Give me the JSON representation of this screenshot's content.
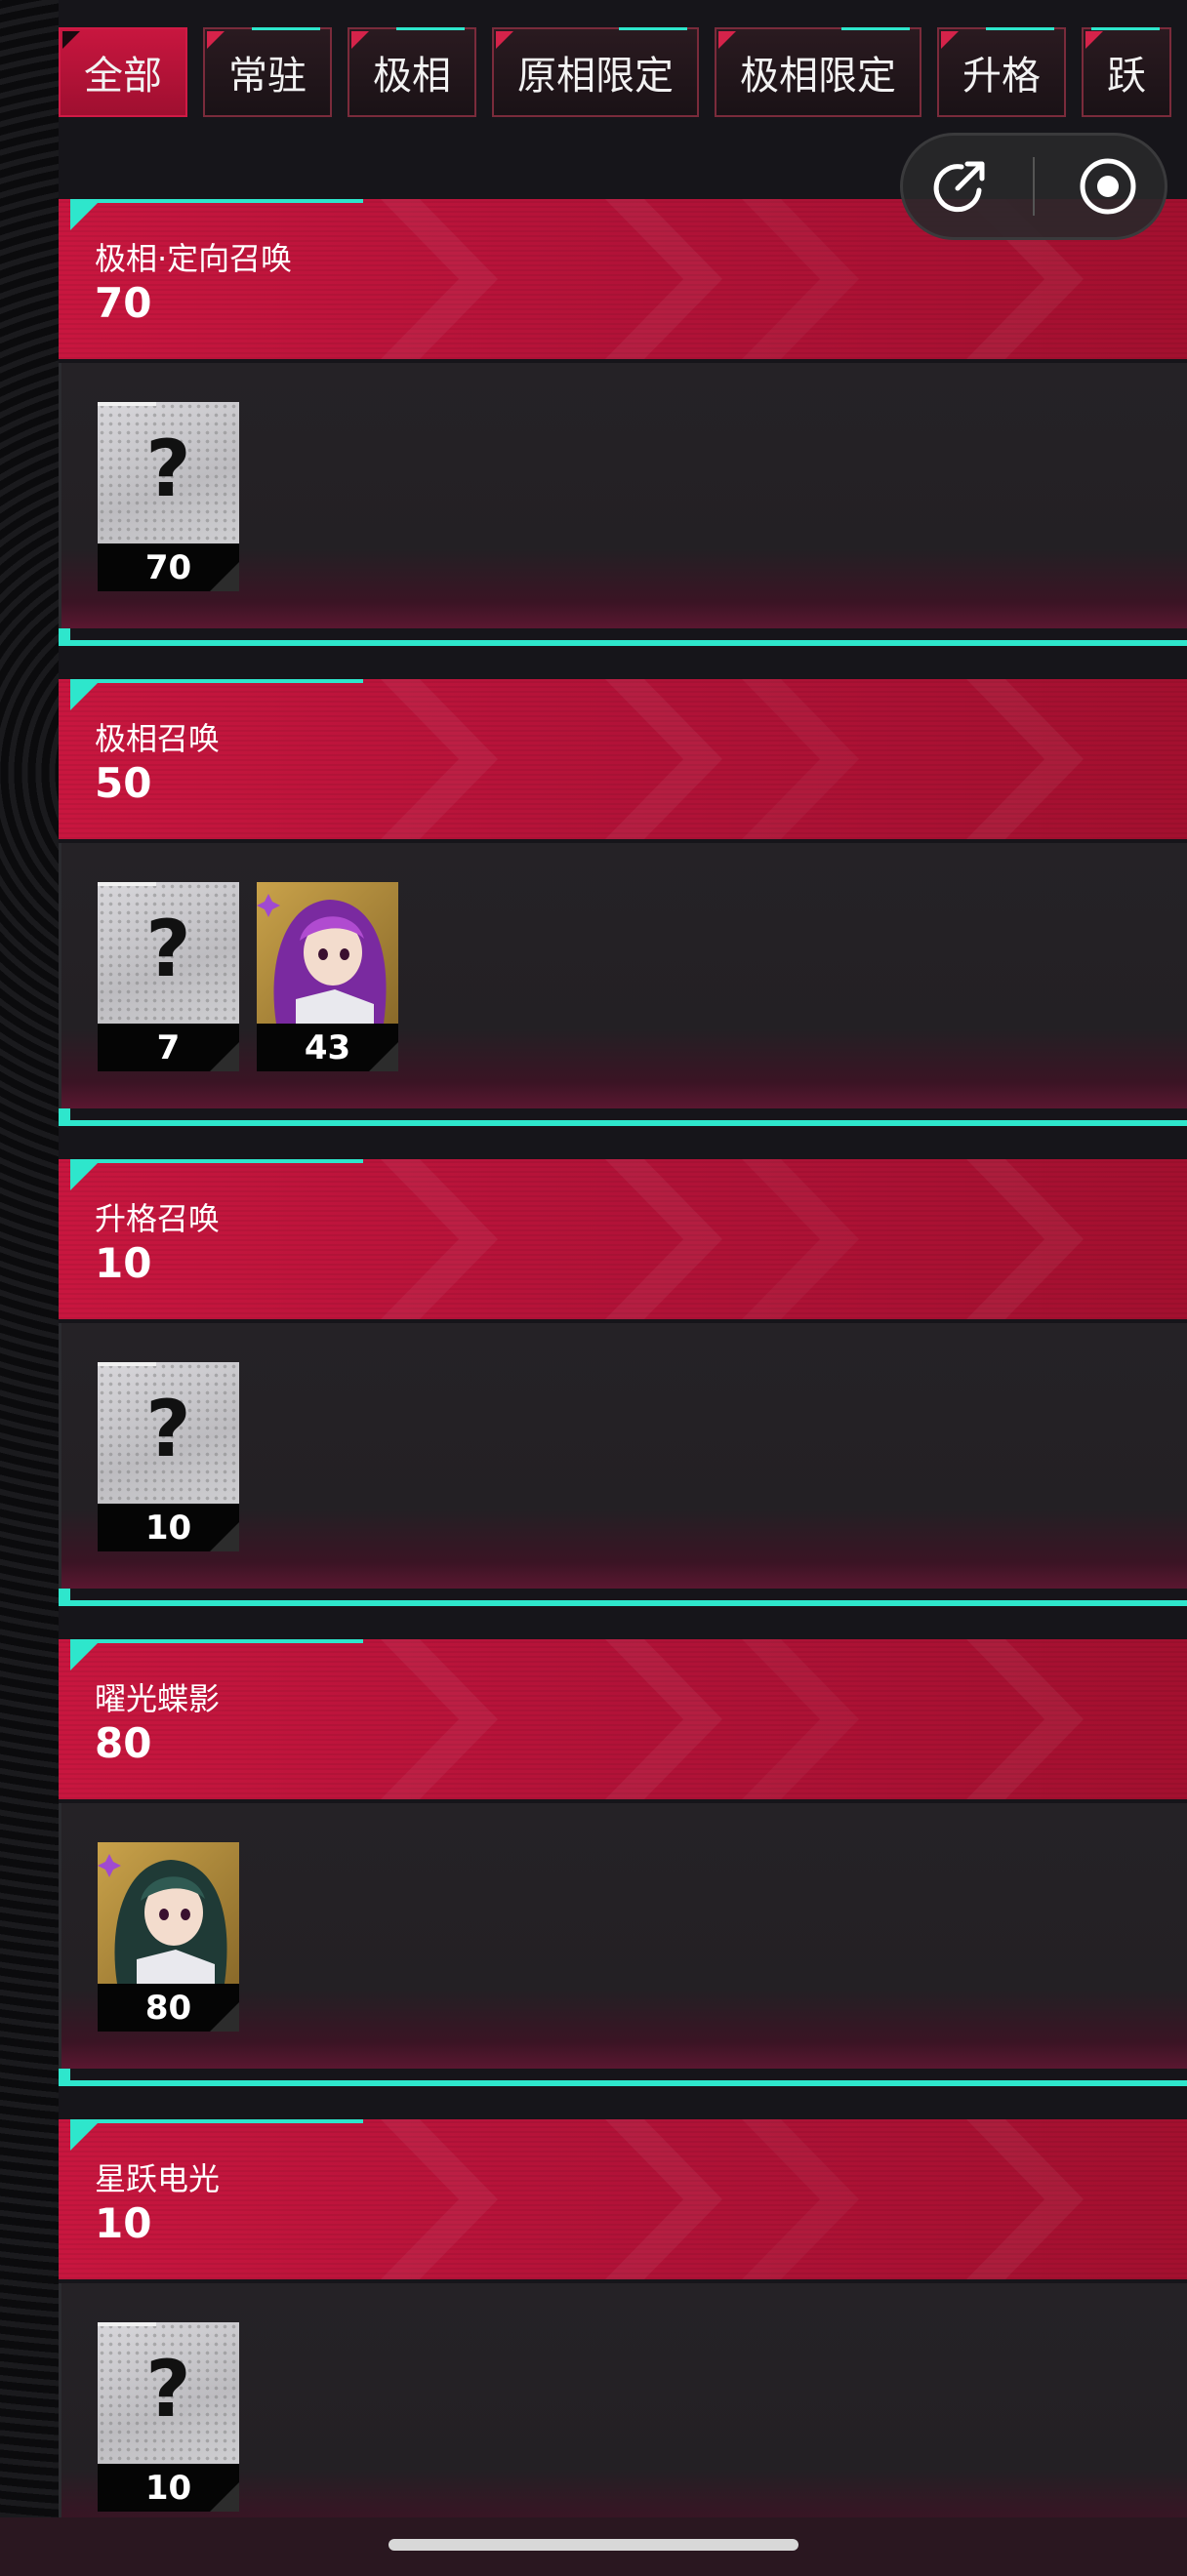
{
  "tabs": [
    {
      "label": "全部",
      "active": true
    },
    {
      "label": "常驻",
      "active": false
    },
    {
      "label": "极相",
      "active": false
    },
    {
      "label": "原相限定",
      "active": false
    },
    {
      "label": "极相限定",
      "active": false
    },
    {
      "label": "升格",
      "active": false
    },
    {
      "label": "跃",
      "active": false
    }
  ],
  "capsule": {
    "share_icon": "share-arrow-icon",
    "record_icon": "record-icon"
  },
  "sections": [
    {
      "name": "极相·定向召唤",
      "count": "70",
      "cards": [
        {
          "type": "unknown",
          "symbol": "?",
          "value": "70"
        }
      ]
    },
    {
      "name": "极相召唤",
      "count": "50",
      "cards": [
        {
          "type": "unknown",
          "symbol": "?",
          "value": "7"
        },
        {
          "type": "character",
          "portrait": "purple-hair",
          "value": "43"
        }
      ]
    },
    {
      "name": "升格召唤",
      "count": "10",
      "cards": [
        {
          "type": "unknown",
          "symbol": "?",
          "value": "10"
        }
      ]
    },
    {
      "name": "曜光蝶影",
      "count": "80",
      "cards": [
        {
          "type": "character",
          "portrait": "green-hair",
          "value": "80"
        }
      ]
    },
    {
      "name": "星跃电光",
      "count": "10",
      "cards": [
        {
          "type": "unknown",
          "symbol": "?",
          "value": "10"
        }
      ]
    }
  ],
  "colors": {
    "accent": "#2ee6cc",
    "header": "#c8163f"
  }
}
